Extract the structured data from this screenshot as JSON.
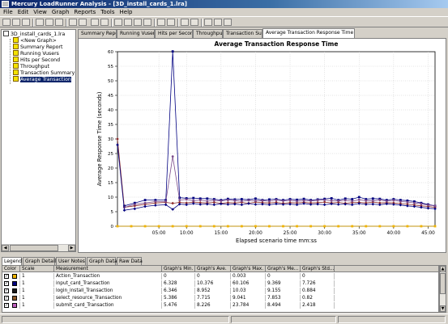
{
  "window": {
    "title": "Mercury LoadRunner Analysis - [3D_install_cards_1.lra]"
  },
  "menu": [
    "File",
    "Edit",
    "View",
    "Graph",
    "Reports",
    "Tools",
    "Help"
  ],
  "tree": {
    "root": "3D_install_cards_1.lra",
    "items": [
      "<New Graph>",
      "Summary Report",
      "Running Vusers",
      "Hits per Second",
      "Throughput",
      "Transaction Summary",
      "Average Transaction"
    ],
    "selected_index": 6
  },
  "graph_tabs": [
    "Summary Report",
    "Running Vusers",
    "Hits per Second",
    "Throughput",
    "Transaction Summary",
    "Average Transaction Response Time"
  ],
  "active_graph_tab": 5,
  "chart_data": {
    "type": "line",
    "title": "Average Transaction Response Time",
    "xlabel": "Elapsed scenario time mm:ss",
    "ylabel": "Average Response Time (seconds)",
    "ylim": [
      0,
      60
    ],
    "xlim": [
      0,
      2760
    ],
    "y_ticks": [
      0,
      5,
      10,
      15,
      20,
      25,
      30,
      35,
      40,
      45,
      50,
      55,
      60
    ],
    "x_ticks": [
      {
        "t": 360,
        "label": "05:00"
      },
      {
        "t": 600,
        "label": "10:00"
      },
      {
        "t": 900,
        "label": "15:00"
      },
      {
        "t": 1200,
        "label": "20:00"
      },
      {
        "t": 1500,
        "label": "25:00"
      },
      {
        "t": 1800,
        "label": "30:00"
      },
      {
        "t": 2100,
        "label": "35:00"
      },
      {
        "t": 2400,
        "label": "40:00"
      },
      {
        "t": 2700,
        "label": "45:00"
      }
    ],
    "grid": true,
    "series": [
      {
        "name": "Action_Transaction",
        "color": "#f0b400",
        "x": [
          0,
          120,
          240,
          360,
          480,
          600,
          720,
          840,
          960,
          1080,
          1200,
          1320,
          1440,
          1560,
          1680,
          1800,
          1920,
          2040,
          2160,
          2280,
          2400,
          2520,
          2640,
          2760
        ],
        "values": [
          0,
          0,
          0,
          0,
          0,
          0,
          0,
          0,
          0,
          0,
          0,
          0,
          0,
          0,
          0,
          0,
          0,
          0,
          0,
          0,
          0,
          0,
          0,
          0
        ]
      },
      {
        "name": "input_card_Transaction",
        "color": "#000080",
        "x": [
          60,
          150,
          240,
          330,
          420,
          480,
          540,
          600,
          660,
          720,
          780,
          840,
          900,
          960,
          1020,
          1080,
          1140,
          1200,
          1260,
          1320,
          1380,
          1440,
          1500,
          1560,
          1620,
          1680,
          1740,
          1800,
          1860,
          1920,
          1980,
          2040,
          2100,
          2160,
          2220,
          2280,
          2340,
          2400,
          2460,
          2520,
          2580,
          2640,
          2700,
          2760
        ],
        "values": [
          7.0,
          8.0,
          9.0,
          9.0,
          9.0,
          60.1,
          9.8,
          9.6,
          9.7,
          9.5,
          9.5,
          9.3,
          9.0,
          9.4,
          9.2,
          9.3,
          9.1,
          9.5,
          9.0,
          9.2,
          9.3,
          9.0,
          9.3,
          9.1,
          9.4,
          9.0,
          9.2,
          9.4,
          9.6,
          9.0,
          9.5,
          9.3,
          10.0,
          9.3,
          9.5,
          9.4,
          9.0,
          9.3,
          9.0,
          8.8,
          8.5,
          8.0,
          7.5,
          7.0
        ]
      },
      {
        "name": "login_install_Transaction",
        "color": "#8b2a2a",
        "x": [
          0,
          60,
          150,
          240,
          330,
          420,
          480,
          540,
          600,
          660,
          720,
          780,
          840,
          900,
          960,
          1020,
          1080,
          1140,
          1200,
          1260,
          1320,
          1380,
          1440,
          1500,
          1560,
          1620,
          1680,
          1740,
          1800,
          1860,
          1920,
          1980,
          2040,
          2100,
          2160,
          2220,
          2280,
          2340,
          2400,
          2460,
          2520,
          2580,
          2640,
          2700,
          2760
        ],
        "values": [
          30,
          6.5,
          7.0,
          7.5,
          8.0,
          8.2,
          7.9,
          8.2,
          8.0,
          8.3,
          8.1,
          8.0,
          8.2,
          7.9,
          8.1,
          8.0,
          8.2,
          7.9,
          8.3,
          8.1,
          8.0,
          8.2,
          7.9,
          8.1,
          8.0,
          8.2,
          8.0,
          8.1,
          8.3,
          8.0,
          8.2,
          7.9,
          8.1,
          8.2,
          8.0,
          8.3,
          8.0,
          8.1,
          8.0,
          7.8,
          7.6,
          7.3,
          7.0,
          6.8,
          6.5
        ]
      },
      {
        "name": "select_resource_Transaction",
        "color": "#7a4a8a",
        "x": [
          60,
          150,
          240,
          330,
          420,
          480,
          540,
          600,
          660,
          720,
          780,
          840,
          900,
          960,
          1020,
          1080,
          1140,
          1200,
          1260,
          1320,
          1380,
          1440,
          1500,
          1560,
          1620,
          1680,
          1740,
          1800,
          1860,
          1920,
          1980,
          2040,
          2100,
          2160,
          2220,
          2280,
          2340,
          2400,
          2460,
          2520,
          2580,
          2640,
          2700,
          2760
        ],
        "values": [
          6.5,
          7.5,
          8.0,
          8.5,
          8.5,
          24.0,
          9.0,
          9.2,
          8.8,
          9.0,
          8.6,
          8.9,
          8.7,
          9.0,
          8.8,
          8.6,
          8.9,
          8.7,
          8.8,
          8.6,
          9.0,
          8.7,
          8.9,
          8.6,
          8.8,
          8.7,
          8.9,
          9.0,
          8.8,
          8.7,
          8.9,
          8.6,
          9.1,
          8.8,
          8.7,
          9.0,
          8.6,
          8.9,
          8.5,
          8.3,
          8.0,
          7.7,
          7.3,
          7.0
        ]
      },
      {
        "name": "submit_card_Transaction",
        "color": "#000080",
        "x": [
          0,
          60,
          150,
          240,
          330,
          420,
          480,
          540,
          600,
          660,
          720,
          780,
          840,
          900,
          960,
          1020,
          1080,
          1140,
          1200,
          1260,
          1320,
          1380,
          1440,
          1500,
          1560,
          1620,
          1680,
          1740,
          1800,
          1860,
          1920,
          1980,
          2040,
          2100,
          2160,
          2220,
          2280,
          2340,
          2400,
          2460,
          2520,
          2580,
          2640,
          2700,
          2760
        ],
        "values": [
          28,
          5.5,
          6.0,
          6.8,
          7.2,
          7.4,
          5.8,
          7.6,
          7.4,
          7.8,
          7.5,
          7.6,
          7.4,
          7.7,
          7.5,
          7.6,
          7.4,
          7.8,
          7.5,
          7.6,
          7.4,
          7.7,
          7.5,
          7.6,
          7.4,
          7.8,
          7.5,
          7.6,
          7.4,
          7.7,
          7.5,
          7.6,
          7.4,
          7.8,
          7.5,
          7.6,
          7.4,
          7.7,
          7.5,
          7.3,
          7.0,
          6.8,
          6.5,
          6.2,
          6.0
        ]
      }
    ]
  },
  "bottom_tabs": [
    "Legend",
    "Graph Details",
    "User Notes",
    "Graph Data",
    "Raw Data"
  ],
  "legend": {
    "headers": [
      "Color",
      "Scale",
      "Measurement",
      "Graph's Min.",
      "Graph's Ave.",
      "Graph's Max.",
      "Graph's Me...",
      "Graph's Std..."
    ],
    "rows": [
      {
        "color": "#f0b400",
        "scale": "1",
        "name": "Action_Transaction",
        "min": "0",
        "ave": "0",
        "max": "0.003",
        "med": "0",
        "std": "0"
      },
      {
        "color": "#000080",
        "scale": "1",
        "name": "input_card_Transaction",
        "min": "6.328",
        "ave": "10.376",
        "max": "60.106",
        "med": "9.369",
        "std": "7.726"
      },
      {
        "color": "#1a1a1a",
        "scale": "1",
        "name": "login_install_Transaction",
        "min": "6.346",
        "ave": "8.952",
        "max": "10.03",
        "med": "9.155",
        "std": "0.884"
      },
      {
        "color": "#8b5a2b",
        "scale": "1",
        "name": "select_resource_Transaction",
        "min": "5.386",
        "ave": "7.715",
        "max": "9.041",
        "med": "7.853",
        "std": "0.82"
      },
      {
        "color": "#c060c0",
        "scale": "1",
        "name": "submit_card_Transaction",
        "min": "5.476",
        "ave": "8.226",
        "max": "23.784",
        "med": "8.494",
        "std": "2.418"
      }
    ]
  }
}
